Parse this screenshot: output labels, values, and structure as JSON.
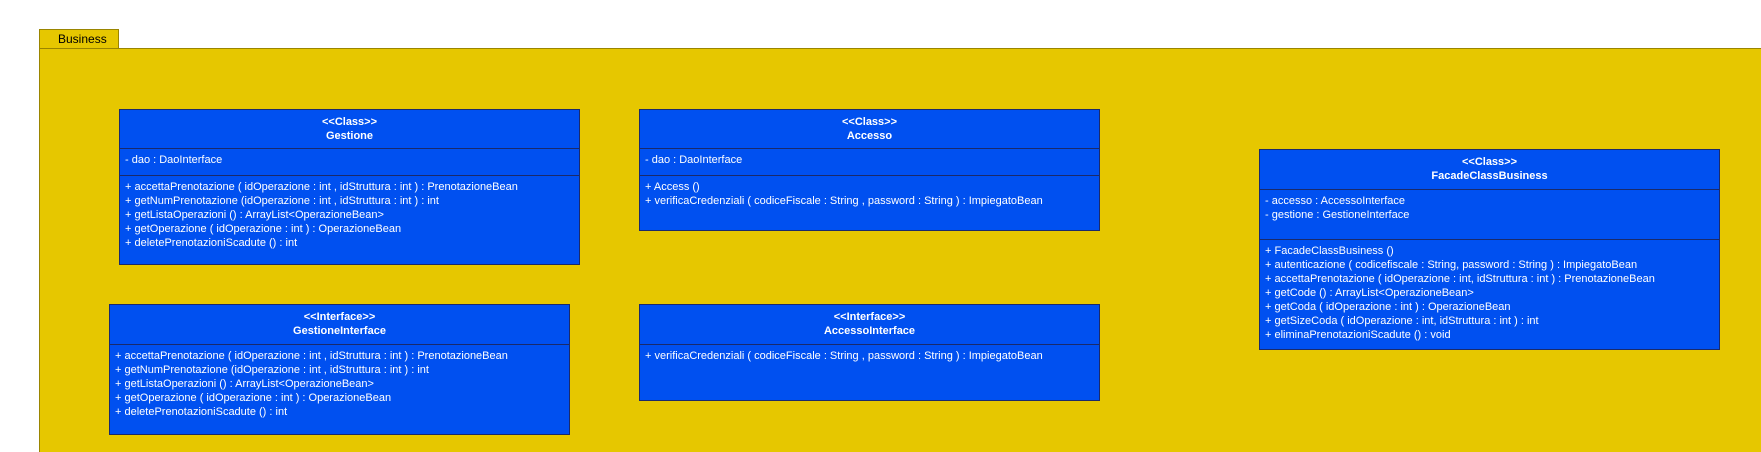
{
  "package": {
    "name": "Business"
  },
  "classes": {
    "gestione": {
      "stereotype": "<<Class>>",
      "name": "Gestione",
      "attributes": [
        "- dao : DaoInterface"
      ],
      "methods": [
        "+ accettaPrenotazione ( idOperazione : int , idStruttura : int ) : PrenotazioneBean",
        "+ getNumPrenotazione (idOperazione : int , idStruttura : int ) : int",
        "+ getListaOperazioni () : ArrayList<OperazioneBean>",
        "+ getOperazione ( idOperazione : int ) : OperazioneBean",
        "+ deletePrenotazioniScadute () : int"
      ]
    },
    "accesso": {
      "stereotype": "<<Class>>",
      "name": "Accesso",
      "attributes": [
        "- dao : DaoInterface"
      ],
      "methods": [
        "+ Access ()",
        "+ verificaCredenziali ( codiceFiscale : String , password : String ) : ImpiegatoBean"
      ]
    },
    "facade": {
      "stereotype": "<<Class>>",
      "name": "FacadeClassBusiness",
      "attributes": [
        "- accesso : AccessoInterface",
        "- gestione : GestioneInterface"
      ],
      "methods": [
        "+ FacadeClassBusiness ()",
        "+ autenticazione ( codicefiscale : String, password : String ) : ImpiegatoBean",
        "+ accettaPrenotazione ( idOperazione : int, idStruttura : int ) : PrenotazioneBean",
        "+ getCode () : ArrayList<OperazioneBean>",
        "+ getCoda ( idOperazione : int ) : OperazioneBean",
        "+ getSizeCoda ( idOperazione : int, idStruttura : int ) : int",
        "+ eliminaPrenotazioniScadute () : void"
      ]
    },
    "gestioneInterface": {
      "stereotype": "<<Interface>>",
      "name": "GestioneInterface",
      "methods": [
        "+ accettaPrenotazione ( idOperazione : int , idStruttura : int ) : PrenotazioneBean",
        "+ getNumPrenotazione (idOperazione : int , idStruttura : int ) : int",
        "+ getListaOperazioni () : ArrayList<OperazioneBean>",
        "+ getOperazione ( idOperazione : int ) : OperazioneBean",
        "+ deletePrenotazioniScadute () : int"
      ]
    },
    "accessoInterface": {
      "stereotype": "<<Interface>>",
      "name": "AccessoInterface",
      "methods": [
        "+ verificaCredenziali ( codiceFiscale : String , password : String ) : ImpiegatoBean"
      ]
    }
  }
}
